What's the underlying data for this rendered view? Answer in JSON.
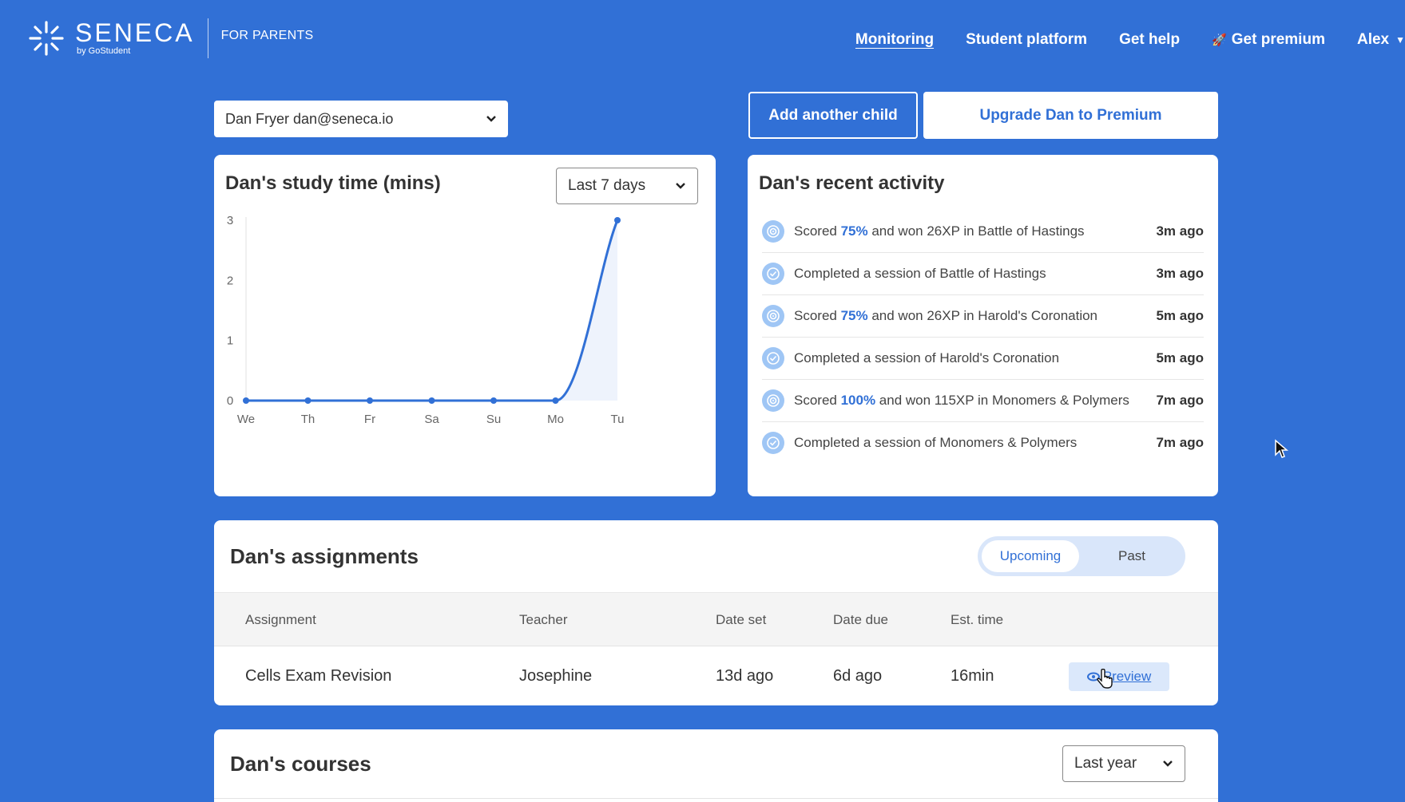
{
  "brand": {
    "name": "SENECA",
    "by": "by GoStudent",
    "section": "FOR PARENTS"
  },
  "nav": {
    "monitoring": "Monitoring",
    "student_platform": "Student platform",
    "get_help": "Get help",
    "get_premium": "Get premium",
    "user": "Alex"
  },
  "child_select": {
    "value": "Dan Fryer dan@seneca.io"
  },
  "actions": {
    "add_child": "Add another child",
    "upgrade": "Upgrade Dan to Premium"
  },
  "study": {
    "title": "Dan's study time (mins)",
    "range": "Last 7 days"
  },
  "chart_data": {
    "type": "line",
    "title": "Dan's study time (mins)",
    "categories": [
      "We",
      "Th",
      "Fr",
      "Sa",
      "Su",
      "Mo",
      "Tu"
    ],
    "values": [
      0,
      0,
      0,
      0,
      0,
      0,
      3
    ],
    "ylim": [
      0,
      3
    ],
    "yticks": [
      "0",
      "1",
      "2",
      "3"
    ],
    "color": "#3170d6",
    "grid": false
  },
  "activity": {
    "title": "Dan's recent activity",
    "items": [
      {
        "pre": "Scored ",
        "hl": "75%",
        "post": " and won 26XP in Battle of Hastings",
        "time": "3m ago",
        "icon": "target-icon"
      },
      {
        "pre": "Completed a session of Battle of Hastings",
        "hl": "",
        "post": "",
        "time": "3m ago",
        "icon": "check-circle-icon"
      },
      {
        "pre": "Scored ",
        "hl": "75%",
        "post": " and won 26XP in Harold's Coronation",
        "time": "5m ago",
        "icon": "target-icon"
      },
      {
        "pre": "Completed a session of Harold's Coronation",
        "hl": "",
        "post": "",
        "time": "5m ago",
        "icon": "check-circle-icon"
      },
      {
        "pre": "Scored ",
        "hl": "100%",
        "post": " and won 115XP in Monomers & Polymers",
        "time": "7m ago",
        "icon": "target-icon"
      },
      {
        "pre": "Completed a session of Monomers & Polymers",
        "hl": "",
        "post": "",
        "time": "7m ago",
        "icon": "check-circle-icon"
      }
    ]
  },
  "assignments": {
    "title": "Dan's assignments",
    "toggle": {
      "upcoming": "Upcoming",
      "past": "Past"
    },
    "columns": [
      "Assignment",
      "Teacher",
      "Date set",
      "Date due",
      "Est. time"
    ],
    "rows": [
      {
        "assignment": "Cells Exam Revision",
        "teacher": "Josephine",
        "date_set": "13d ago",
        "date_due": "6d ago",
        "est_time": "16min",
        "action": "Preview"
      }
    ]
  },
  "courses": {
    "title": "Dan's courses",
    "range": "Last year"
  }
}
